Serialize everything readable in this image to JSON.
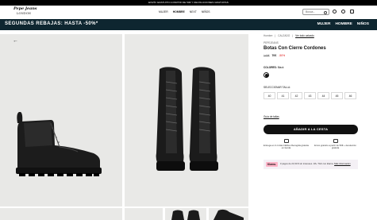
{
  "topbar": {
    "text": "ENVÍO GRATUITO A PARTIR DE 50€ Y DEVOLUCIONES GRATUITAS"
  },
  "header": {
    "logo": "Pepe Jeans",
    "logo_sub": "LONDON",
    "nav": [
      "MUJER",
      "HOMBRE",
      "NEXT",
      "NIÑOS"
    ],
    "search_placeholder": "Busca..."
  },
  "promo": {
    "text": "SEGUNDAS REBAJAS: HASTA -50%*",
    "categories": [
      "MUJER",
      "HOMBRE",
      "NIÑOS"
    ]
  },
  "product": {
    "breadcrumb": [
      "Hombre",
      "CALZADO",
      "Ver todo calzado"
    ],
    "brand": "PEPEJEANS",
    "name": "Botas Con Cierre Cordones",
    "old_price": "140€",
    "price": "70€",
    "discount": "-50%",
    "color_label": "COLORES:",
    "color_value": "Black",
    "size_label": "SELECCIONAR TALLA:",
    "sizes": [
      "40",
      "41",
      "42",
      "43",
      "44",
      "45",
      "46"
    ],
    "size_guide": "Guía de tallas",
    "add_to_cart": "AÑADIR A LA CESTA",
    "features": [
      "Entrega en 2-4 días hábiles\nRecogida gratuita en tienda",
      "Envío gratuito a partir de 50€\n+ devolución gratuita"
    ],
    "klarna_badge": "Klarna.",
    "klarna_text": "3 pagos de 23,33 € sin intereses. 18+ T&C con klarna.",
    "klarna_link": "Más información"
  },
  "colors": {
    "promo_bg": "#0e2630",
    "accent_red": "#d11111"
  }
}
